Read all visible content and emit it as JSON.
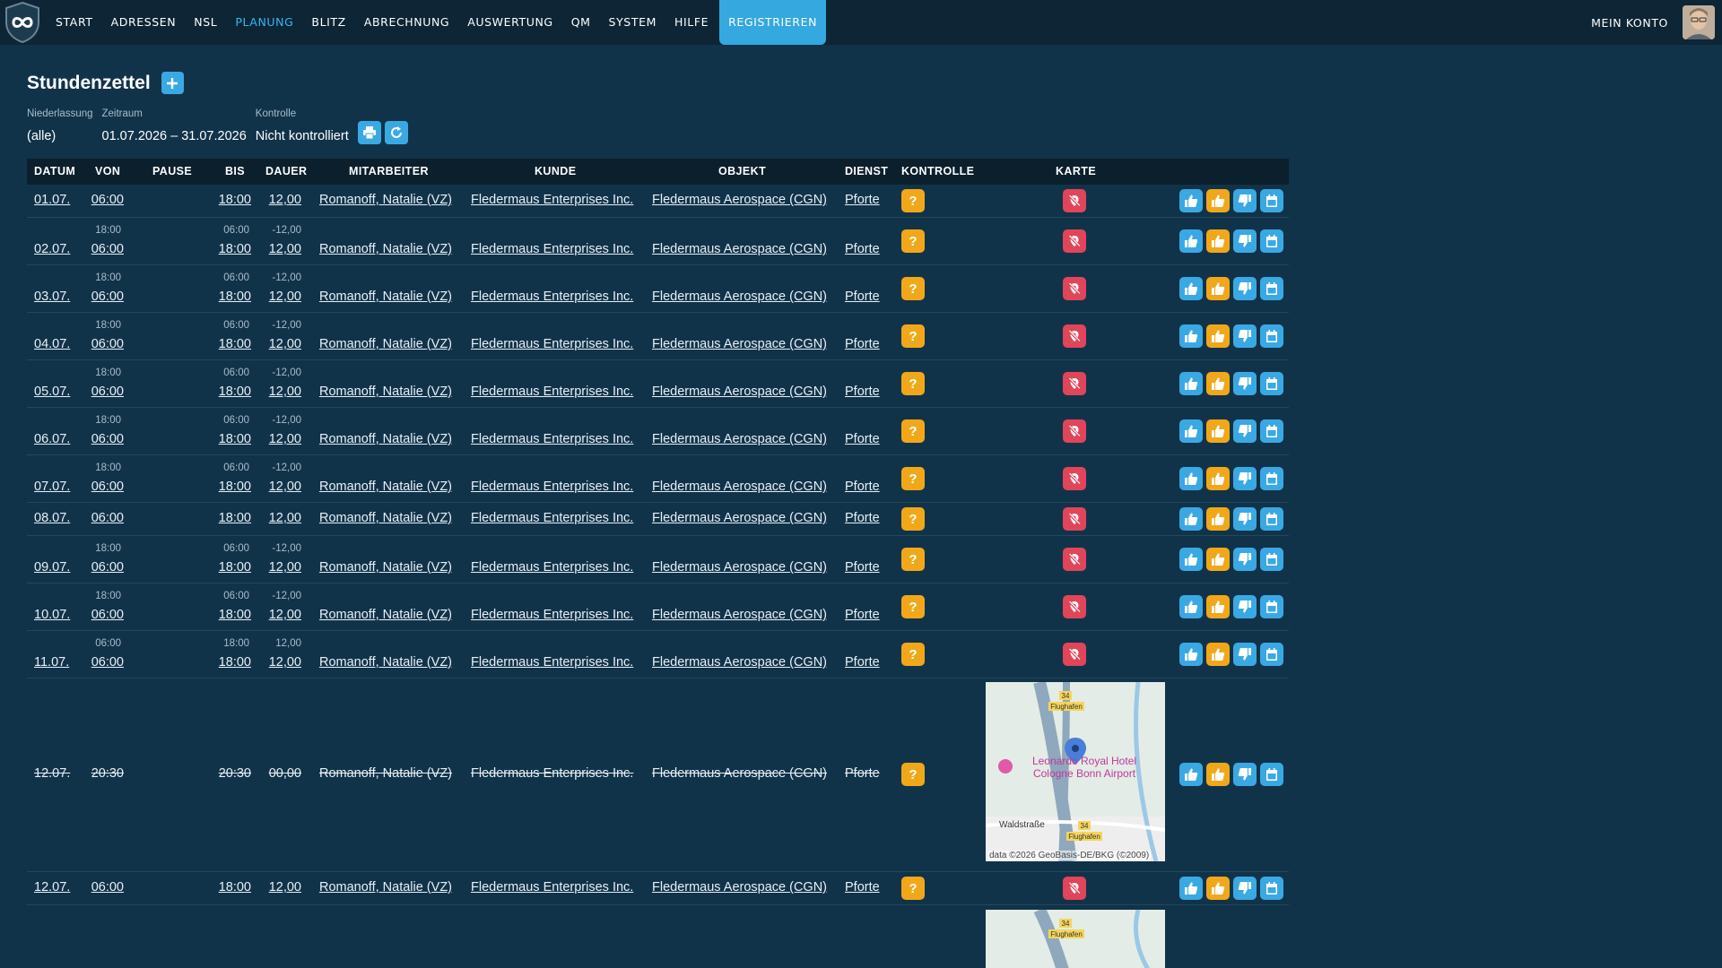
{
  "nav": {
    "items": [
      {
        "label": "START",
        "active": false
      },
      {
        "label": "ADRESSEN",
        "active": false
      },
      {
        "label": "NSL",
        "active": false
      },
      {
        "label": "PLANUNG",
        "active": true
      },
      {
        "label": "BLITZ",
        "active": false
      },
      {
        "label": "ABRECHNUNG",
        "active": false
      },
      {
        "label": "AUSWERTUNG",
        "active": false
      },
      {
        "label": "QM",
        "active": false
      },
      {
        "label": "SYSTEM",
        "active": false
      },
      {
        "label": "HILFE",
        "active": false
      }
    ],
    "register_label": "REGISTRIEREN",
    "account_label": "MEIN KONTO"
  },
  "page": {
    "title": "Stundenzettel",
    "add_icon": "plus-icon"
  },
  "filters": {
    "niederlassung_label": "Niederlassung",
    "niederlassung_value": "(alle)",
    "zeitraum_label": "Zeitraum",
    "zeitraum_value": "01.07.2026 – 31.07.2026",
    "kontrolle_label": "Kontrolle",
    "kontrolle_value": "Nicht kontrolliert"
  },
  "table": {
    "headers": {
      "datum": "DATUM",
      "von": "VON",
      "pause": "PAUSE",
      "bis": "BIS",
      "dauer": "DAUER",
      "mitarbeiter": "MITARBEITER",
      "kunde": "KUNDE",
      "objekt": "OBJEKT",
      "dienst": "DIENST",
      "kontrolle": "KONTROLLE",
      "karte": "KARTE"
    },
    "map_labels": {
      "hotel_line1": "Leonardo Royal Hotel",
      "hotel_line2": "Cologne Bonn Airport",
      "street": "Waldstraße",
      "road_label": "Flughafen",
      "road_number": "34",
      "credit": "data ©2026 GeoBasis-DE/BKG (©2009)"
    },
    "rows": [
      {
        "kind": "simple",
        "datum": "01.07.",
        "von": "06:00",
        "bis": "18:00",
        "dauer": "12,00",
        "mitarbeiter": "Romanoff, Natalie (VZ)",
        "kunde": "Fledermaus Enterprises Inc.",
        "objekt": "Fledermaus Aerospace (CGN)",
        "dienst": "Pforte"
      },
      {
        "kind": "double",
        "datum": "02.07.",
        "von_small": "18:00",
        "von": "06:00",
        "bis_small": "06:00",
        "bis": "18:00",
        "dauer_small": "-12,00",
        "dauer": "12,00",
        "mitarbeiter": "Romanoff, Natalie (VZ)",
        "kunde": "Fledermaus Enterprises Inc.",
        "objekt": "Fledermaus Aerospace (CGN)",
        "dienst": "Pforte"
      },
      {
        "kind": "double",
        "datum": "03.07.",
        "von_small": "18:00",
        "von": "06:00",
        "bis_small": "06:00",
        "bis": "18:00",
        "dauer_small": "-12,00",
        "dauer": "12,00",
        "mitarbeiter": "Romanoff, Natalie (VZ)",
        "kunde": "Fledermaus Enterprises Inc.",
        "objekt": "Fledermaus Aerospace (CGN)",
        "dienst": "Pforte"
      },
      {
        "kind": "double",
        "datum": "04.07.",
        "von_small": "18:00",
        "von": "06:00",
        "bis_small": "06:00",
        "bis": "18:00",
        "dauer_small": "-12,00",
        "dauer": "12,00",
        "mitarbeiter": "Romanoff, Natalie (VZ)",
        "kunde": "Fledermaus Enterprises Inc.",
        "objekt": "Fledermaus Aerospace (CGN)",
        "dienst": "Pforte"
      },
      {
        "kind": "double",
        "datum": "05.07.",
        "von_small": "18:00",
        "von": "06:00",
        "bis_small": "06:00",
        "bis": "18:00",
        "dauer_small": "-12,00",
        "dauer": "12,00",
        "mitarbeiter": "Romanoff, Natalie (VZ)",
        "kunde": "Fledermaus Enterprises Inc.",
        "objekt": "Fledermaus Aerospace (CGN)",
        "dienst": "Pforte"
      },
      {
        "kind": "double",
        "datum": "06.07.",
        "von_small": "18:00",
        "von": "06:00",
        "bis_small": "06:00",
        "bis": "18:00",
        "dauer_small": "-12,00",
        "dauer": "12,00",
        "mitarbeiter": "Romanoff, Natalie (VZ)",
        "kunde": "Fledermaus Enterprises Inc.",
        "objekt": "Fledermaus Aerospace (CGN)",
        "dienst": "Pforte"
      },
      {
        "kind": "double",
        "datum": "07.07.",
        "von_small": "18:00",
        "von": "06:00",
        "bis_small": "06:00",
        "bis": "18:00",
        "dauer_small": "-12,00",
        "dauer": "12,00",
        "mitarbeiter": "Romanoff, Natalie (VZ)",
        "kunde": "Fledermaus Enterprises Inc.",
        "objekt": "Fledermaus Aerospace (CGN)",
        "dienst": "Pforte"
      },
      {
        "kind": "simple",
        "datum": "08.07.",
        "von": "06:00",
        "bis": "18:00",
        "dauer": "12,00",
        "mitarbeiter": "Romanoff, Natalie (VZ)",
        "kunde": "Fledermaus Enterprises Inc.",
        "objekt": "Fledermaus Aerospace (CGN)",
        "dienst": "Pforte"
      },
      {
        "kind": "double",
        "datum": "09.07.",
        "von_small": "18:00",
        "von": "06:00",
        "bis_small": "06:00",
        "bis": "18:00",
        "dauer_small": "-12,00",
        "dauer": "12,00",
        "mitarbeiter": "Romanoff, Natalie (VZ)",
        "kunde": "Fledermaus Enterprises Inc.",
        "objekt": "Fledermaus Aerospace (CGN)",
        "dienst": "Pforte"
      },
      {
        "kind": "double",
        "datum": "10.07.",
        "von_small": "18:00",
        "von": "06:00",
        "bis_small": "06:00",
        "bis": "18:00",
        "dauer_small": "-12,00",
        "dauer": "12,00",
        "mitarbeiter": "Romanoff, Natalie (VZ)",
        "kunde": "Fledermaus Enterprises Inc.",
        "objekt": "Fledermaus Aerospace (CGN)",
        "dienst": "Pforte"
      },
      {
        "kind": "double",
        "datum": "11.07.",
        "von_small": "06:00",
        "von": "06:00",
        "bis_small": "18:00",
        "bis": "18:00",
        "dauer_small": "12,00",
        "dauer": "12,00",
        "mitarbeiter": "Romanoff, Natalie (VZ)",
        "kunde": "Fledermaus Enterprises Inc.",
        "objekt": "Fledermaus Aerospace (CGN)",
        "dienst": "Pforte"
      },
      {
        "kind": "map",
        "datum": "12.07.",
        "von": "20:30",
        "bis": "20:30",
        "dauer": "00,00",
        "mitarbeiter": "Romanoff, Natalie (VZ)",
        "kunde": "Fledermaus Enterprises Inc.",
        "objekt": "Fledermaus Aerospace (CGN)",
        "dienst": "Pforte"
      },
      {
        "kind": "simple",
        "datum": "12.07.",
        "von": "06:00",
        "bis": "18:00",
        "dauer": "12,00",
        "mitarbeiter": "Romanoff, Natalie (VZ)",
        "kunde": "Fledermaus Enterprises Inc.",
        "objekt": "Fledermaus Aerospace (CGN)",
        "dienst": "Pforte"
      }
    ]
  },
  "icons": {
    "logo": "infinity-shield-icon",
    "print": "print-icon",
    "refresh": "refresh-icon",
    "question": "question-icon",
    "no_location": "location-off-icon",
    "thumb_up": "thumb-up-icon",
    "thumb_down": "thumb-down-icon",
    "calendar": "calendar-icon"
  },
  "colors": {
    "background": "#11334a",
    "nav_background": "#0d2535",
    "accent": "#3aa9e3",
    "warning": "#f0a81a",
    "danger": "#e0455a",
    "active_nav": "#39b6f2"
  }
}
